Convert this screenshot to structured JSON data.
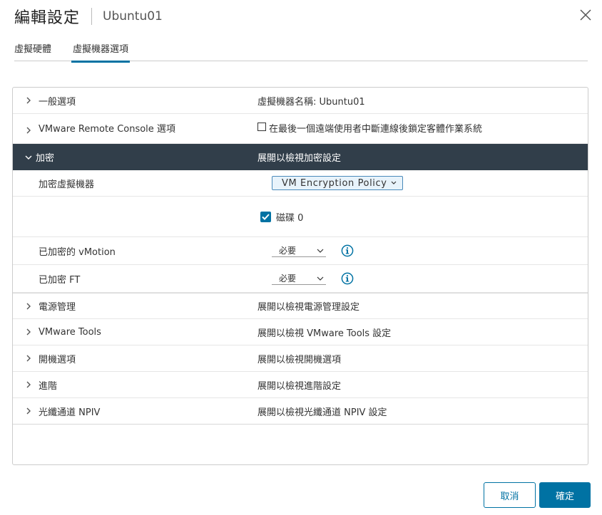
{
  "dialog": {
    "title": "編輯設定",
    "vm_name": "Ubuntu01"
  },
  "tabs": [
    {
      "label": "虛擬硬體",
      "active": false
    },
    {
      "label": "虛擬機器選項",
      "active": true
    }
  ],
  "rows": {
    "general": {
      "label": "一般選項",
      "value": "虛擬機器名稱: Ubuntu01"
    },
    "vmrc": {
      "label": "VMware Remote Console 選項",
      "checkbox_label": "在最後一個遠端使用者中斷連線後鎖定客體作業系統",
      "checked": false
    },
    "encryption": {
      "label": "加密",
      "value": "展開以檢視加密設定",
      "encrypt_vm": {
        "label": "加密虛擬機器",
        "policy": "VM Encryption Policy"
      },
      "disk": {
        "label": "磁碟 0",
        "checked": true
      },
      "vmotion": {
        "label": "已加密的 vMotion",
        "value": "必要"
      },
      "ft": {
        "label": "已加密 FT",
        "value": "必要"
      }
    },
    "power": {
      "label": "電源管理",
      "value": "展開以檢視電源管理設定"
    },
    "tools": {
      "label": "VMware Tools",
      "value": "展開以檢視 VMware Tools 設定"
    },
    "boot": {
      "label": "開機選項",
      "value": "展開以檢視開機選項"
    },
    "advanced": {
      "label": "進階",
      "value": "展開以檢視進階設定"
    },
    "npiv": {
      "label": "光纖通道 NPIV",
      "value": "展開以檢視光纖通道 NPIV 設定"
    }
  },
  "footer": {
    "cancel_label": "取消",
    "ok_label": "確定"
  },
  "colors": {
    "accent": "#0072a3",
    "expanded_row_bg": "#313e4a"
  }
}
